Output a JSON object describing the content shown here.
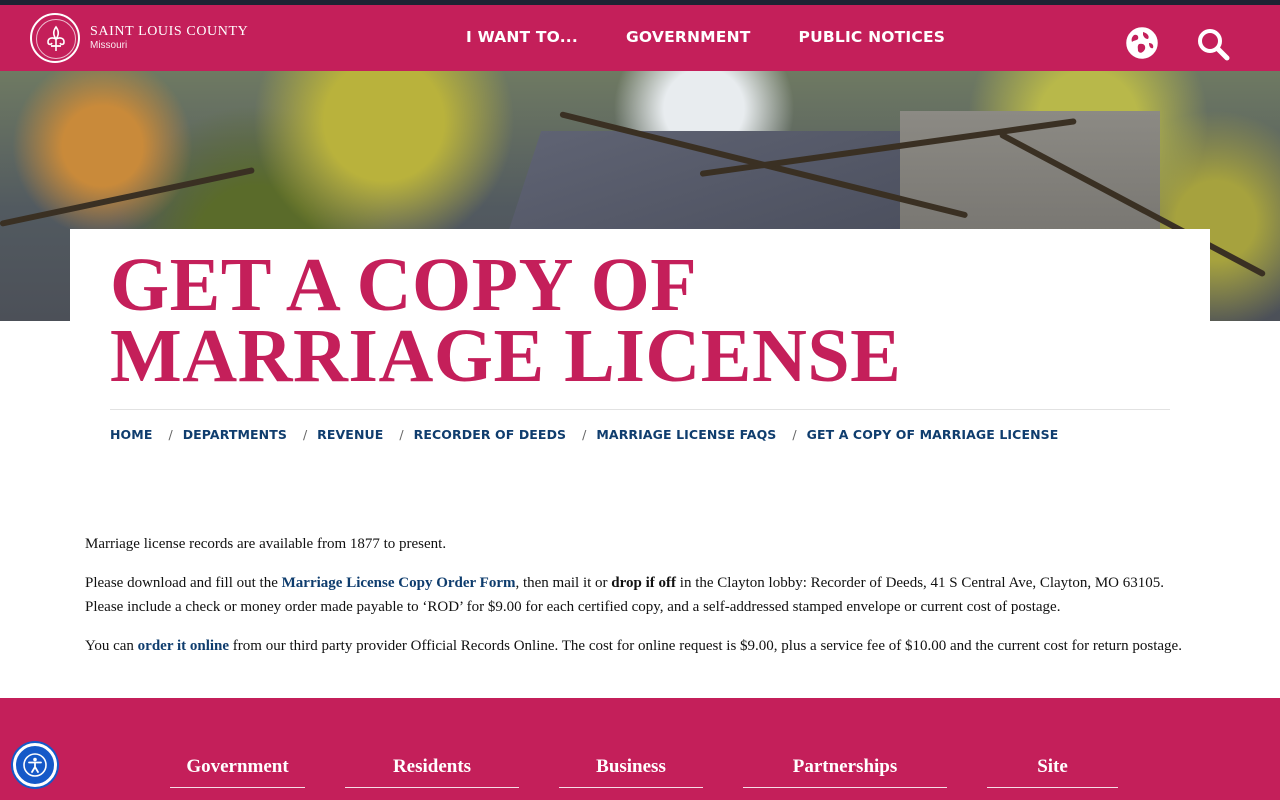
{
  "header": {
    "logo_title": "SAINT LOUIS COUNTY",
    "logo_sub": "Missouri",
    "nav": [
      "I WANT TO...",
      "GOVERNMENT",
      "PUBLIC NOTICES"
    ],
    "icons": [
      "fleur-de-lis-seal-icon",
      "globe-icon",
      "search-icon"
    ],
    "colors": {
      "brand": "#c41f5a",
      "topline": "#1d2333",
      "link": "#0f3d6e"
    }
  },
  "page": {
    "title": "GET A COPY OF MARRIAGE LICENSE"
  },
  "breadcrumb": [
    "HOME",
    "DEPARTMENTS",
    "REVENUE",
    "RECORDER OF DEEDS",
    "MARRIAGE LICENSE FAQS",
    "GET A COPY OF MARRIAGE LICENSE"
  ],
  "content": {
    "p1": "Marriage license records are available from 1877 to present.",
    "p2_pre": "Please download and fill out the ",
    "p2_link": "Marriage License Copy Order Form",
    "p2_mid": ", then mail it or ",
    "p2_bold": "drop if off",
    "p2_post": " in the Clayton lobby:  Recorder of Deeds, 41 S Central Ave, Clayton, MO 63105.  Please include a check or money order made payable to ‘ROD’ for $9.00 for each certified copy, and a self-addressed stamped envelope or current cost of postage.",
    "p3_pre": "You can ",
    "p3_link": "order it online",
    "p3_post": " from our third party provider Official Records Online.  The cost for online request is $9.00, plus a service fee of $10.00 and the current cost for return postage."
  },
  "footer": {
    "columns": [
      "Government",
      "Residents",
      "Business",
      "Partnerships",
      "Site"
    ]
  },
  "accessibility": {
    "icon": "accessibility-person-icon"
  }
}
